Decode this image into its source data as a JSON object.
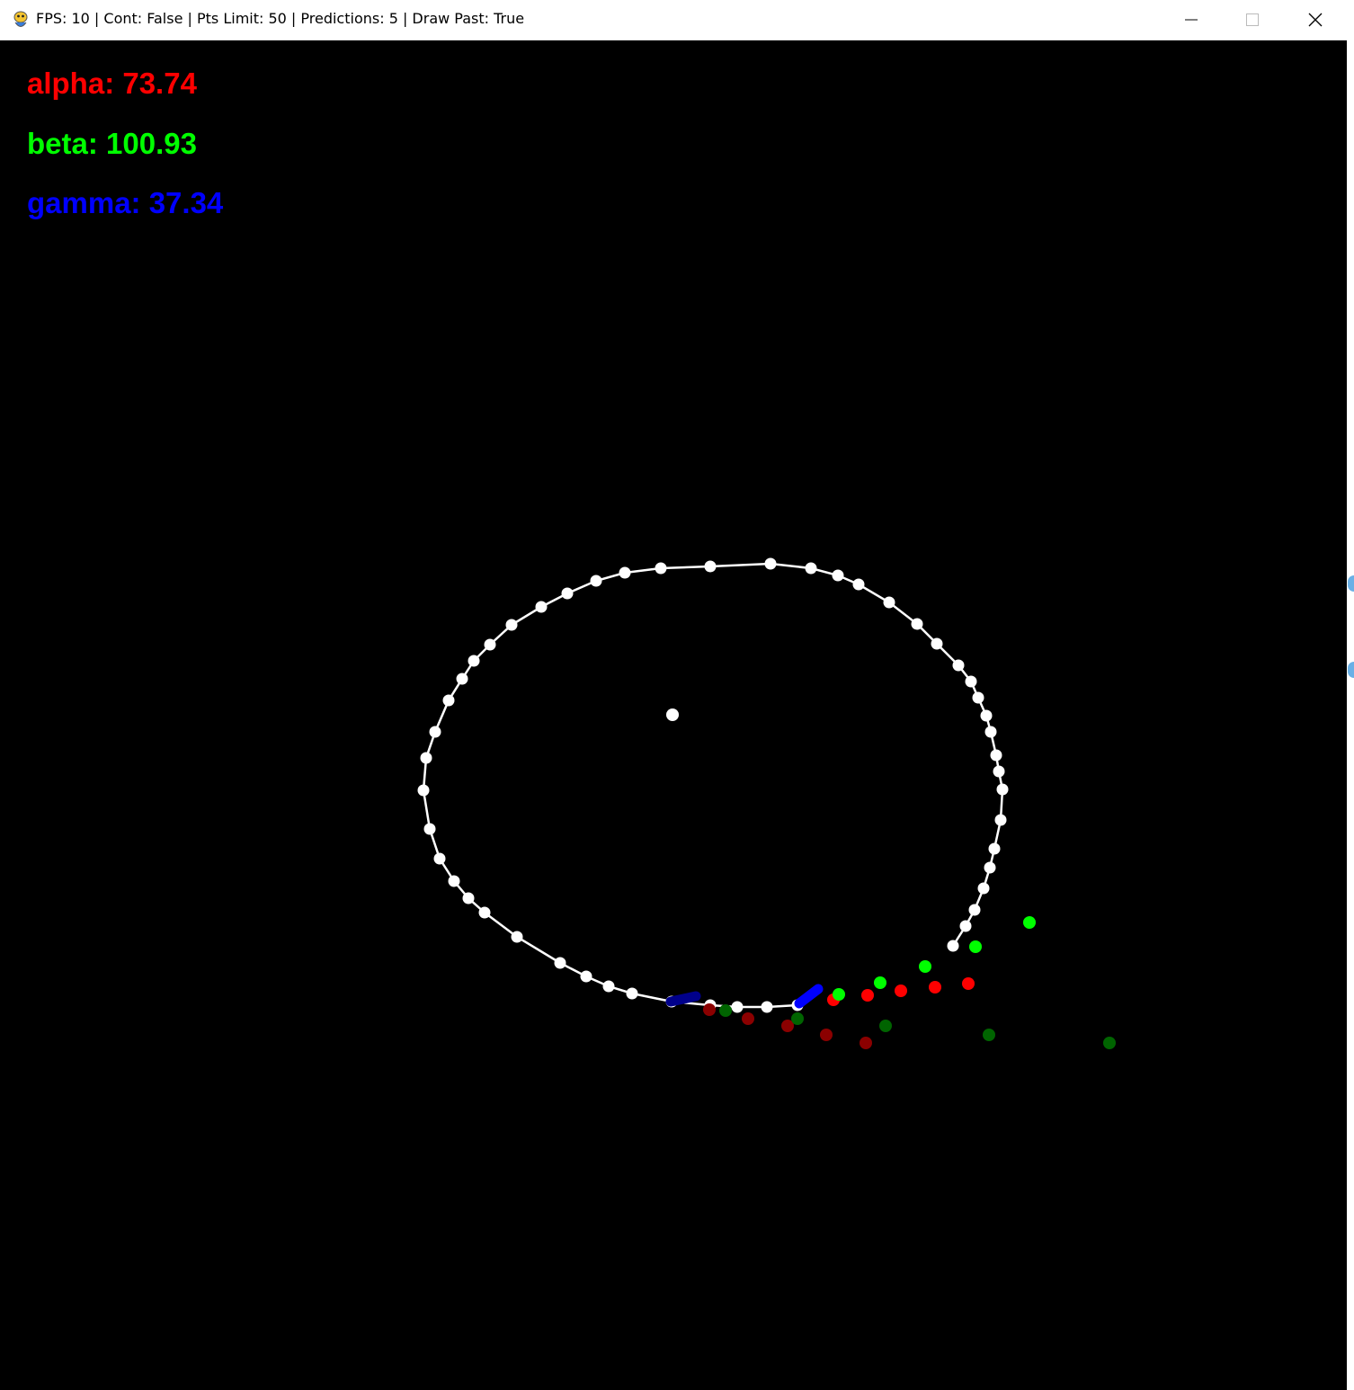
{
  "window": {
    "title": "FPS: 10 | Cont: False | Pts Limit: 50 | Predictions: 5 | Draw Past: True",
    "app_icon": "pygame-snake-icon",
    "controls": [
      "minimize-icon",
      "maximize-icon",
      "close-icon"
    ]
  },
  "hud": {
    "alpha": "alpha: 73.74",
    "beta": "beta: 100.93",
    "gamma": "gamma: 37.34"
  },
  "colors": {
    "background": "#000000",
    "trail": "#ffffff",
    "alpha": "#ff0000",
    "beta": "#00ff00",
    "gamma": "#0000ff",
    "past_alpha": "#8b0000",
    "past_beta": "#006400",
    "past_gamma": "#00008b"
  }
}
